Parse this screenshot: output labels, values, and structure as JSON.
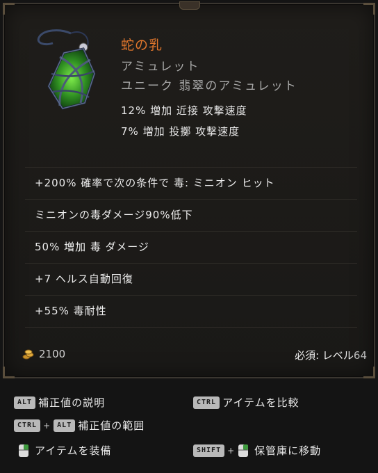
{
  "item": {
    "name": "蛇の乳",
    "type": "アミュレット",
    "base": "ユニーク 翡翠のアミュレット",
    "implicits": [
      "12% 増加 近接 攻撃速度",
      "7% 増加 投擲 攻撃速度"
    ],
    "modifiers": [
      "+200% 確率で次の条件で 毒: ミニオン ヒット",
      "ミニオンの毒ダメージ90%低下",
      "50% 増加 毒 ダメージ",
      "+7 ヘルス自動回復",
      "+55% 毒耐性"
    ],
    "gold_value": "2100",
    "requirement_label": "必須: レベル",
    "requirement_level": "64",
    "name_color": "#e0762c",
    "icon": "jade-amulet-icon"
  },
  "hints": {
    "h1": {
      "keys": [
        "ALT"
      ],
      "label": "補正値の説明"
    },
    "h2": {
      "keys": [
        "CTRL"
      ],
      "label": "アイテムを比較"
    },
    "h3": {
      "keys": [
        "CTRL",
        "ALT"
      ],
      "label": "補正値の範囲"
    },
    "h4": {
      "keys": [],
      "label": "アイテムを装備"
    },
    "h5": {
      "keys": [
        "SHIFT"
      ],
      "label": "保管庫に移動"
    }
  },
  "icons": {
    "gold": "gold-coins-icon",
    "mouse": "right-mouse-button-icon"
  }
}
